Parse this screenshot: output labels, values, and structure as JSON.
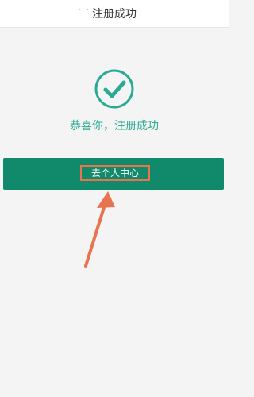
{
  "header": {
    "back_dots": "· · ·",
    "title": "注册成功"
  },
  "status": {
    "icon": "check-circle-icon",
    "message": "恭喜你，注册成功",
    "accent_color": "#2aaa92"
  },
  "actions": {
    "primary_label": "去个人中心",
    "primary_color": "#118a6b",
    "highlight_color": "#e8734f"
  },
  "annotation": {
    "arrow_color": "#e8734f"
  }
}
